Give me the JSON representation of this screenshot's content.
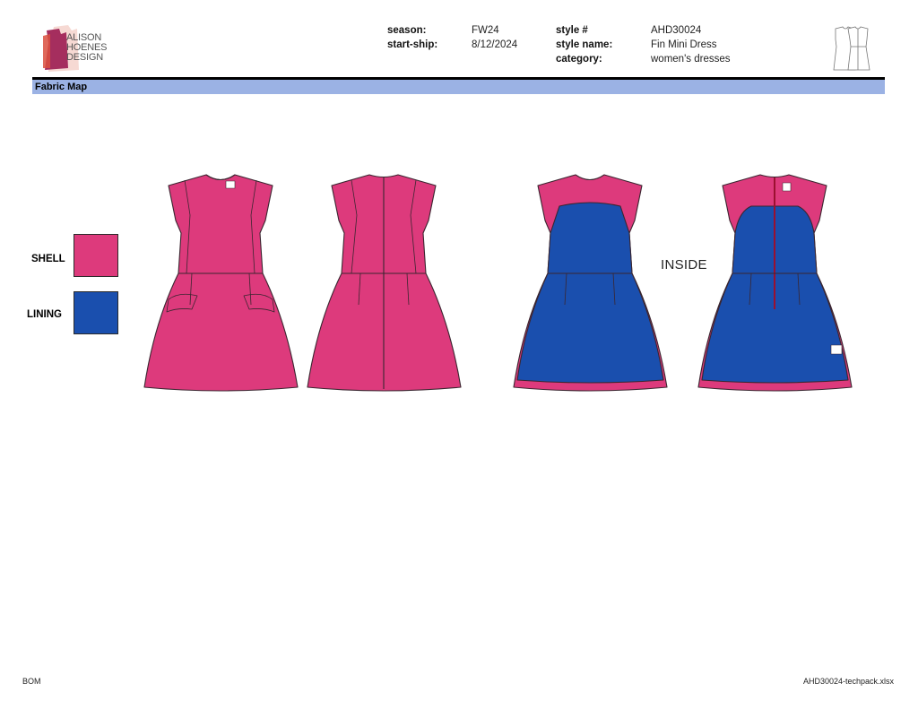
{
  "brand": {
    "logo_lines": [
      "ALISON",
      "HOENES",
      "DESIGN"
    ]
  },
  "header": {
    "season_label": "season:",
    "season_value": "FW24",
    "start_ship_label": "start-ship:",
    "start_ship_value": "8/12/2024",
    "style_no_label": "style #",
    "style_no_value": "AHD30024",
    "style_name_label": "style name:",
    "style_name_value": "Fin Mini Dress",
    "category_label": "category:",
    "category_value": "women's dresses"
  },
  "section": {
    "title": "Fabric Map"
  },
  "legend": [
    {
      "label": "SHELL",
      "color": "#dd3a7c"
    },
    {
      "label": "LINING",
      "color": "#1a4fae"
    }
  ],
  "inside_label": "INSIDE",
  "colors": {
    "shell": "#dd3a7c",
    "lining": "#1a4fae",
    "section_bar": "#9bb2e4",
    "outline": "#3a2630"
  },
  "footer": {
    "left": "BOM",
    "right": "AHD30024-techpack.xlsx"
  }
}
